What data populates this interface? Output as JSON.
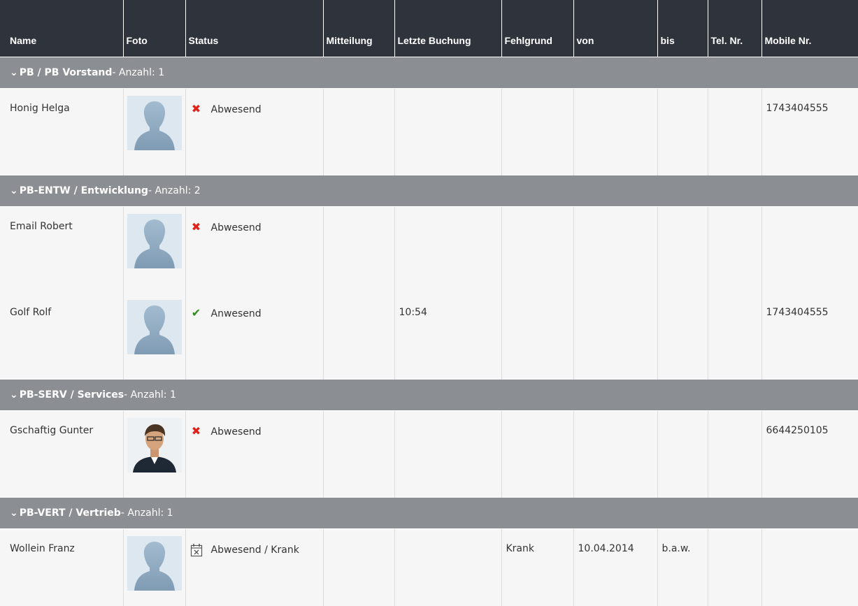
{
  "columns": {
    "name": "Name",
    "foto": "Foto",
    "status": "Status",
    "mitteilung": "Mitteilung",
    "letzte_buchung": "Letzte Buchung",
    "fehlgrund": "Fehlgrund",
    "von": "von",
    "bis": "bis",
    "tel": "Tel. Nr.",
    "mobile": "Mobile Nr."
  },
  "groups": [
    {
      "name": "PB / PB Vorstand",
      "count_label": "- Anzahl: 1",
      "members": [
        {
          "name": "Honig Helga",
          "photo": "silhouette",
          "status_icon": "cross-icon",
          "status": "Abwesend",
          "mitteilung": "",
          "letzte_buchung": "",
          "fehlgrund": "",
          "von": "",
          "bis": "",
          "tel": "",
          "mobile": "1743404555"
        }
      ]
    },
    {
      "name": "PB-ENTW / Entwicklung",
      "count_label": "- Anzahl: 2",
      "members": [
        {
          "name": "Email Robert",
          "photo": "silhouette",
          "status_icon": "cross-icon",
          "status": "Abwesend",
          "mitteilung": "",
          "letzte_buchung": "",
          "fehlgrund": "",
          "von": "",
          "bis": "",
          "tel": "",
          "mobile": ""
        },
        {
          "name": "Golf Rolf",
          "photo": "silhouette",
          "status_icon": "check-icon",
          "status": "Anwesend",
          "mitteilung": "",
          "letzte_buchung": "10:54",
          "fehlgrund": "",
          "von": "",
          "bis": "",
          "tel": "",
          "mobile": "1743404555"
        }
      ]
    },
    {
      "name": "PB-SERV / Services",
      "count_label": "- Anzahl: 1",
      "members": [
        {
          "name": "Gschaftig Gunter",
          "photo": "portrait",
          "status_icon": "cross-icon",
          "status": "Abwesend",
          "mitteilung": "",
          "letzte_buchung": "",
          "fehlgrund": "",
          "von": "",
          "bis": "",
          "tel": "",
          "mobile": "6644250105"
        }
      ]
    },
    {
      "name": "PB-VERT / Vertrieb",
      "count_label": "- Anzahl: 1",
      "members": [
        {
          "name": "Wollein Franz",
          "photo": "silhouette",
          "status_icon": "calendar-x-icon",
          "status": "Abwesend / Krank",
          "mitteilung": "",
          "letzte_buchung": "",
          "fehlgrund": "Krank",
          "von": "10.04.2014",
          "bis": "b.a.w.",
          "tel": "",
          "mobile": ""
        }
      ]
    }
  ],
  "colors": {
    "header_bg": "#2f343c",
    "group_bg": "#8b8e92",
    "row_bg": "#f6f6f6",
    "absent": "#e0221b",
    "present": "#2f8a1f"
  }
}
